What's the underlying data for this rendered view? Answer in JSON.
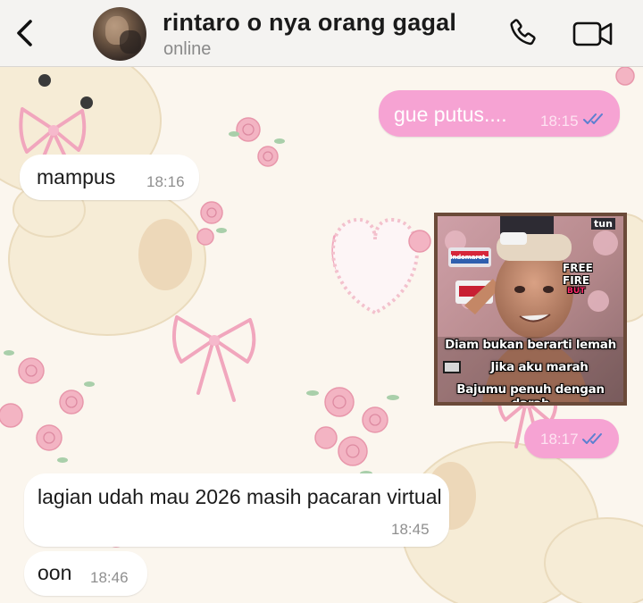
{
  "header": {
    "contact_name": "rintaro o nya orang gagal",
    "status": "online",
    "icons": {
      "back": "chevron-left-icon",
      "call": "phone-icon",
      "video": "video-camera-icon"
    }
  },
  "colors": {
    "outgoing_bubble": "#f6a3d3",
    "incoming_bubble": "#ffffff",
    "read_ticks": "#5b7fd0",
    "header_bg": "#f4f3f1"
  },
  "messages": [
    {
      "direction": "out",
      "text": "gue putus....",
      "time": "18:15",
      "status": "read"
    },
    {
      "direction": "in",
      "text": "mampus",
      "time": "18:16"
    },
    {
      "direction": "out",
      "type": "image",
      "time": "18:17",
      "status": "read",
      "image": {
        "top_tag": "tun",
        "brand_tag": "FREE FIRE",
        "sub_tag": "BUT",
        "store_tag": "Indomaret",
        "lines": [
          "Diam bukan berarti lemah",
          "Jika aku marah",
          "Bajumu penuh dengan darah"
        ]
      }
    },
    {
      "direction": "in",
      "text": "lagian udah mau 2026 masih pacaran virtual",
      "time": "18:45"
    },
    {
      "direction": "in",
      "text": "oon",
      "time": "18:46"
    }
  ]
}
